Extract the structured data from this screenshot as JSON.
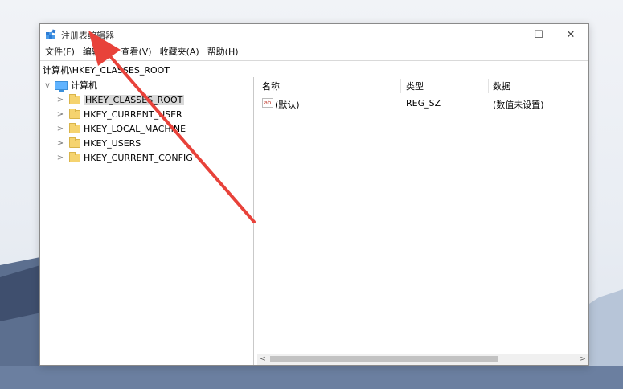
{
  "window": {
    "title": "注册表编辑器",
    "controls": {
      "minimize": "—",
      "maximize": "☐",
      "close": "✕"
    }
  },
  "menu": [
    "文件(F)",
    "编辑(E)",
    "查看(V)",
    "收藏夹(A)",
    "帮助(H)"
  ],
  "address": "计算机\\HKEY_CLASSES_ROOT",
  "tree": {
    "root": "计算机",
    "items": [
      "HKEY_CLASSES_ROOT",
      "HKEY_CURRENT_USER",
      "HKEY_LOCAL_MACHINE",
      "HKEY_USERS",
      "HKEY_CURRENT_CONFIG"
    ]
  },
  "list": {
    "headers": {
      "name": "名称",
      "type": "类型",
      "data": "数据"
    },
    "rows": [
      {
        "name": "(默认)",
        "type": "REG_SZ",
        "data": "(数值未设置)"
      }
    ]
  },
  "colors": {
    "annotation_arrow": "#e8423a",
    "folder": "#f5d36f"
  }
}
